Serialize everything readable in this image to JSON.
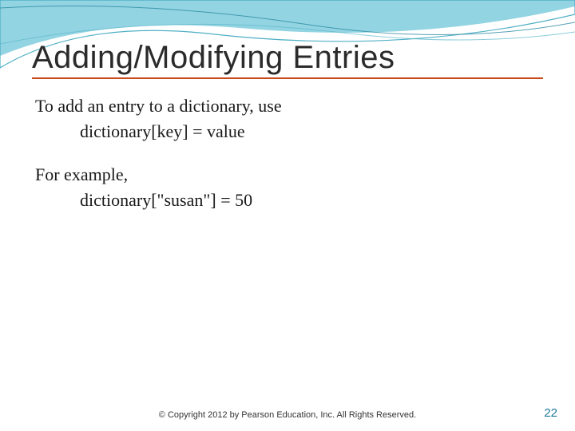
{
  "slide": {
    "title": "Adding/Modifying Entries",
    "line1": "To add an entry to a dictionary, use",
    "line2": "dictionary[key] = value",
    "line3": "For example,",
    "line4": "dictionary[\"susan\"] = 50",
    "copyright": "© Copyright 2012 by Pearson Education, Inc. All Rights Reserved.",
    "page": "22"
  }
}
